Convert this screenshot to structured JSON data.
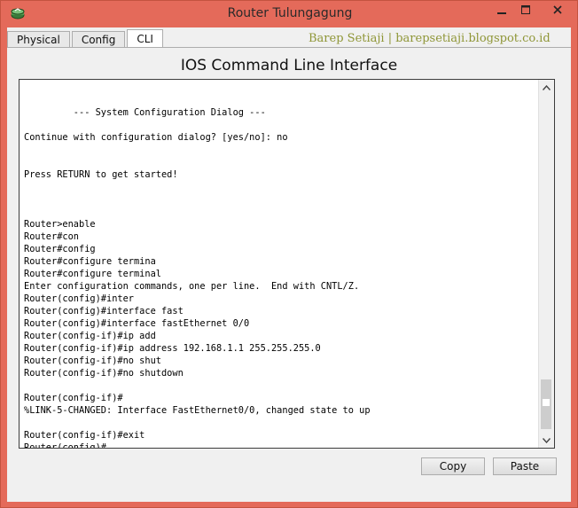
{
  "window": {
    "title": "Router Tulungagung",
    "icon": "router-icon"
  },
  "tabs": [
    {
      "label": "Physical",
      "active": false
    },
    {
      "label": "Config",
      "active": false
    },
    {
      "label": "CLI",
      "active": true
    }
  ],
  "watermark": "Barep Setiaji | barepsetiaji.blogspot.co.id",
  "cli": {
    "heading": "IOS Command Line Interface",
    "lines": [
      "",
      "",
      "         --- System Configuration Dialog ---",
      "",
      "Continue with configuration dialog? [yes/no]: no",
      "",
      "",
      "Press RETURN to get started!",
      "",
      "",
      "",
      "Router>enable",
      "Router#con",
      "Router#config",
      "Router#configure termina",
      "Router#configure terminal",
      "Enter configuration commands, one per line.  End with CNTL/Z.",
      "Router(config)#inter",
      "Router(config)#interface fast",
      "Router(config)#interface fastEthernet 0/0",
      "Router(config-if)#ip add",
      "Router(config-if)#ip address 192.168.1.1 255.255.255.0",
      "Router(config-if)#no shut",
      "Router(config-if)#no shutdown",
      "",
      "Router(config-if)#",
      "%LINK-5-CHANGED: Interface FastEthernet0/0, changed state to up",
      "",
      "Router(config-if)#exit",
      "Router(config)#"
    ]
  },
  "buttons": {
    "copy": "Copy",
    "paste": "Paste"
  },
  "colors": {
    "titlebar": "#e46a5a",
    "watermark": "#8f9637"
  }
}
